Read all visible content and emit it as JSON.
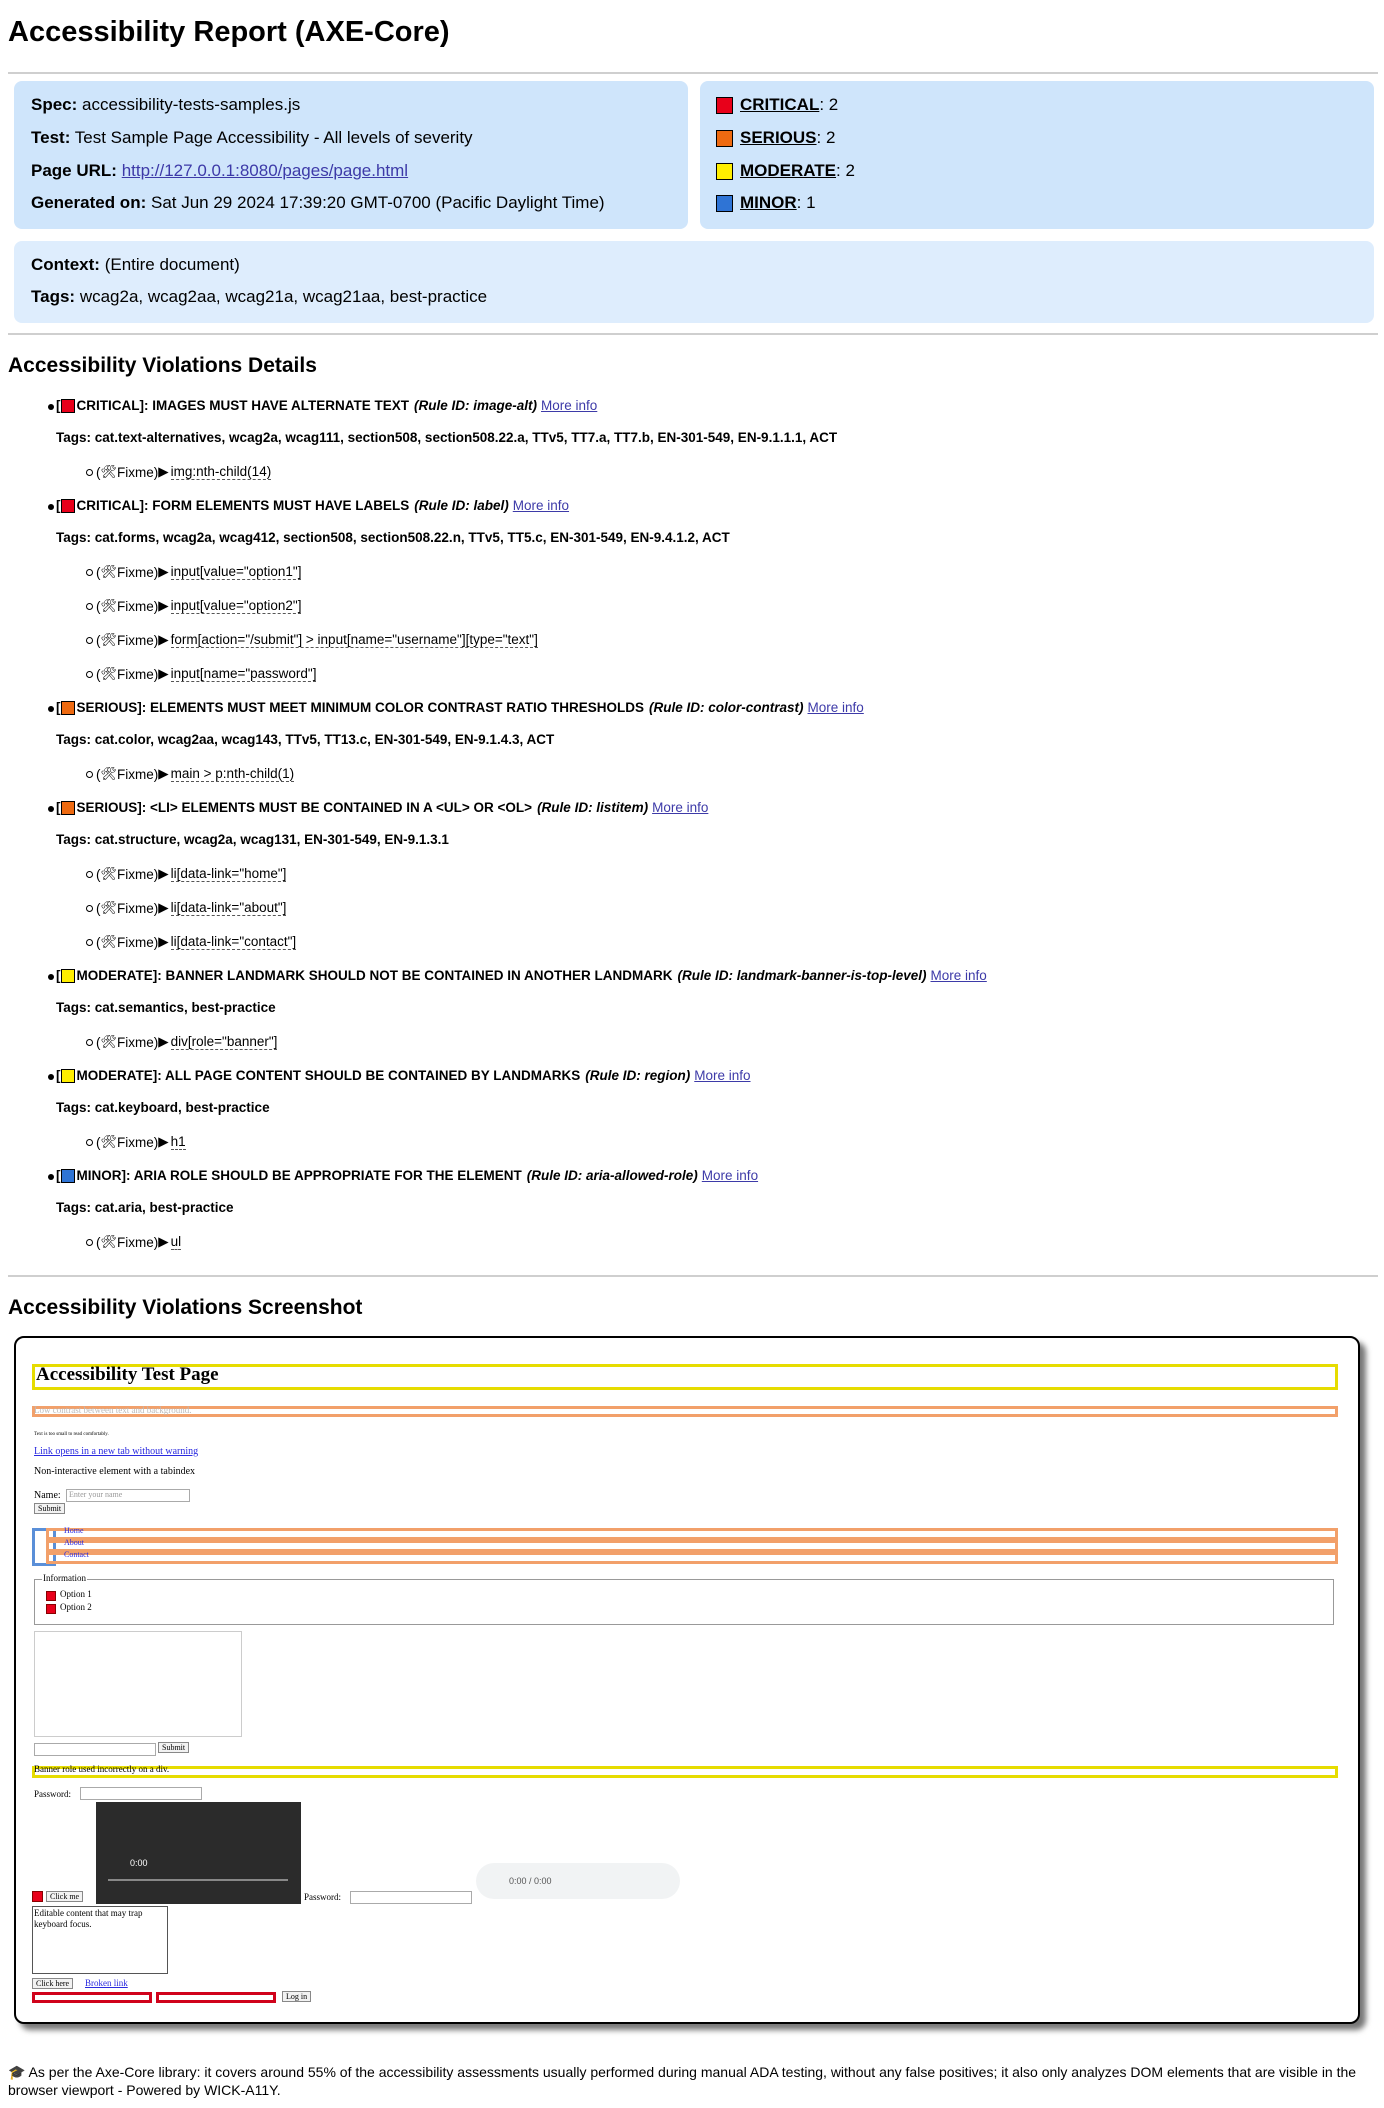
{
  "title": "Accessibility Report (AXE-Core)",
  "summary": {
    "spec_label": "Spec:",
    "spec": "accessibility-tests-samples.js",
    "test_label": "Test:",
    "test": "Test Sample Page Accessibility - All levels of severity",
    "url_label": "Page URL:",
    "url": "http://127.0.0.1:8080/pages/page.html",
    "generated_label": "Generated on:",
    "generated": "Sat Jun 29 2024 17:39:20 GMT-0700 (Pacific Daylight Time)"
  },
  "counts": [
    {
      "label": "CRITICAL",
      "value": ": 2",
      "color": "#e8001a"
    },
    {
      "label": "SERIOUS",
      "value": ": 2",
      "color": "#ee6a11"
    },
    {
      "label": "MODERATE",
      "value": ": 2",
      "color": "#ffee00"
    },
    {
      "label": "MINOR",
      "value": ": 1",
      "color": "#2f74d5"
    }
  ],
  "context": {
    "context_label": "Context:",
    "context": "(Entire document)",
    "tags_label": "Tags:",
    "tags": "wcag2a, wcag2aa, wcag21a, wcag21aa, best-practice"
  },
  "details_heading": "Accessibility Violations Details",
  "violations": [
    {
      "severity": "CRITICAL",
      "color": "#e8001a",
      "text": "]: IMAGES MUST HAVE ALTERNATE TEXT",
      "rule": "(Rule ID: image-alt)",
      "more": "More info",
      "tags": "Tags: cat.text-alternatives, wcag2a, wcag111, section508, section508.22.a, TTv5, TT7.a, TT7.b, EN-301-549, EN-9.1.1.1, ACT",
      "nodes": [
        "img:nth-child(14)"
      ]
    },
    {
      "severity": "CRITICAL",
      "color": "#e8001a",
      "text": "]: FORM ELEMENTS MUST HAVE LABELS",
      "rule": "(Rule ID: label)",
      "more": "More info",
      "tags": "Tags: cat.forms, wcag2a, wcag412, section508, section508.22.n, TTv5, TT5.c, EN-301-549, EN-9.4.1.2, ACT",
      "nodes": [
        "input[value=\"option1\"]",
        "input[value=\"option2\"]",
        "form[action=\"/submit\"] > input[name=\"username\"][type=\"text\"]",
        "input[name=\"password\"]"
      ]
    },
    {
      "severity": "SERIOUS",
      "color": "#ee6a11",
      "text": "]: ELEMENTS MUST MEET MINIMUM COLOR CONTRAST RATIO THRESHOLDS",
      "rule": "(Rule ID: color-contrast)",
      "more": "More info",
      "tags": "Tags: cat.color, wcag2aa, wcag143, TTv5, TT13.c, EN-301-549, EN-9.1.4.3, ACT",
      "nodes": [
        "main > p:nth-child(1)"
      ]
    },
    {
      "severity": "SERIOUS",
      "color": "#ee6a11",
      "text": "]: <LI> ELEMENTS MUST BE CONTAINED IN A <UL> OR <OL>",
      "rule": "(Rule ID: listitem)",
      "more": "More info",
      "tags": "Tags: cat.structure, wcag2a, wcag131, EN-301-549, EN-9.1.3.1",
      "nodes": [
        "li[data-link=\"home\"]",
        "li[data-link=\"about\"]",
        "li[data-link=\"contact\"]"
      ]
    },
    {
      "severity": "MODERATE",
      "color": "#ffee00",
      "text": "]: BANNER LANDMARK SHOULD NOT BE CONTAINED IN ANOTHER LANDMARK",
      "rule": "(Rule ID: landmark-banner-is-top-level)",
      "more": "More info",
      "tags": "Tags: cat.semantics, best-practice",
      "nodes": [
        "div[role=\"banner\"]"
      ]
    },
    {
      "severity": "MODERATE",
      "color": "#ffee00",
      "text": "]: ALL PAGE CONTENT SHOULD BE CONTAINED BY LANDMARKS",
      "rule": "(Rule ID: region)",
      "more": "More info",
      "tags": "Tags: cat.keyboard, best-practice",
      "nodes": [
        "h1"
      ]
    },
    {
      "severity": "MINOR",
      "color": "#2f74d5",
      "text": "]: ARIA ROLE SHOULD BE APPROPRIATE FOR THE ELEMENT",
      "rule": "(Rule ID: aria-allowed-role)",
      "more": "More info",
      "tags": "Tags: cat.aria, best-practice",
      "nodes": [
        "ul"
      ]
    }
  ],
  "fixme_label": "Fixme)",
  "screenshot_heading": "Accessibility Violations Screenshot",
  "shot": {
    "h1": "Accessibility Test Page",
    "low_contrast": "Low contrast between text and background.",
    "small_text": "Text is too small to read comfortably.",
    "link_new_tab": "Link opens in a new tab without warning",
    "non_interactive": "Non-interactive element with a tabindex",
    "name_label": "Name:",
    "name_placeholder": "Enter your name",
    "submit": "Submit",
    "nav_items": [
      "Home",
      "About",
      "Contact"
    ],
    "fieldset_legend": "Information",
    "option1": "Option 1",
    "option2": "Option 2",
    "submit2": "Submit",
    "banner_text": "Banner role used incorrectly on a div.",
    "password_label": "Password:",
    "video_time": "0:00",
    "audio_time": "0:00 / 0:00",
    "click_me": "Click me",
    "password_label2": "Password:",
    "editable": "Editable content that may trap keyboard focus.",
    "click_here": "Click here",
    "broken_link": "Broken link",
    "login": "Log in"
  },
  "footer": "🎓 As per the Axe-Core library: it covers around 55% of the accessibility assessments usually performed during manual ADA testing, without any false positives; it also only analyzes DOM elements that are visible in the browser viewport - Powered by WICK-A11Y."
}
